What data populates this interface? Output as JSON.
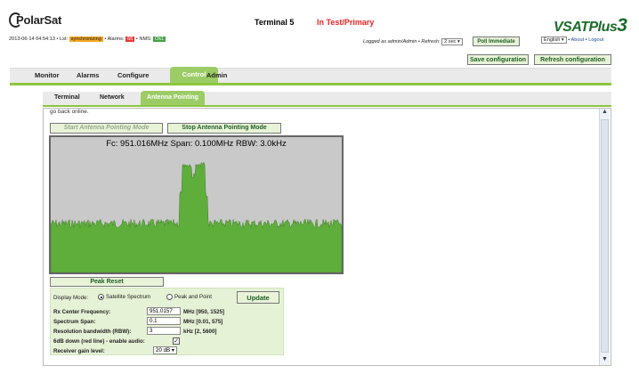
{
  "header": {
    "brand": "PolarSat",
    "terminal": "Terminal 5",
    "mode": "In Test/Primary",
    "product": "VSATPlus",
    "product_suffix": "3",
    "timestamp": "2013-06-14 04:54:13",
    "lstat_label": "• Lst:",
    "lstat_value": "synchronizing",
    "alarms_label": "• Alarms:",
    "alarms_value": "66",
    "nms_label": "• NMS:",
    "nms_value": "Ok1",
    "logged_in": "Logged as admin/Admin",
    "refresh_label": "• Refresh:",
    "refresh_value": "2 sec",
    "poll_label": "Poll Immediate",
    "language": "English",
    "about": "About",
    "logout": "Logout",
    "save_config": "Save configuration",
    "refresh_config": "Refresh configuration"
  },
  "nav": {
    "monitor": "Monitor",
    "alarms": "Alarms",
    "configure": "Configure",
    "control": "Control",
    "admin": "Admin"
  },
  "subnav": {
    "terminal": "Terminal",
    "network": "Network",
    "antenna_pointing": "Antenna Pointing"
  },
  "panel": {
    "online_text": "go back online.",
    "start_label": "Start Antenna Pointing Mode",
    "stop_label": "Stop Antenna Pointing Mode",
    "spectrum_title": "Fc: 951.016MHz Span: 0.100MHz RBW: 3.0kHz",
    "peak_reset": "Peak Reset",
    "display_mode_label": "Display Mode:",
    "mode_spectrum": "Satellite Spectrum",
    "mode_peak": "Peak and Point",
    "update_label": "Update",
    "rx_label": "Rx Center Frequency:",
    "rx_value": "951.0157",
    "rx_hint": "MHz [950, 1525]",
    "span_label": "Spectrum Span:",
    "span_value": "0.1",
    "span_hint": "MHz [0.01, 575]",
    "rbw_label": "Resolution bandwidth (RBW):",
    "rbw_value": "3",
    "rbw_hint": "kHz [2, 5600]",
    "audio_label": "6dB down (red line) - enable audio:",
    "gain_label": "Receiver gain level:",
    "gain_value": "20 dB"
  },
  "colors": {
    "accent_green": "#9ccc65",
    "spectrum_fill": "#5fae3c",
    "alarm_red": "#e53935"
  }
}
